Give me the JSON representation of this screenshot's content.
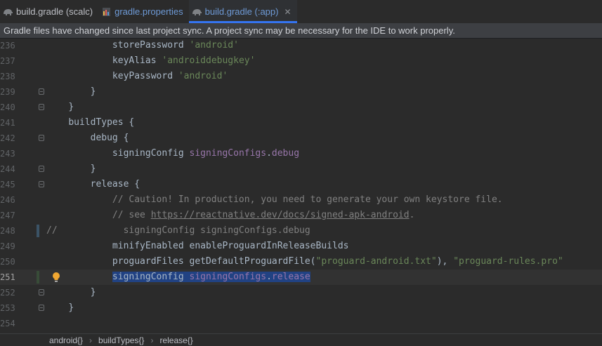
{
  "tabs": [
    {
      "label": "build.gradle (scalc)",
      "icon": "gradle-elephant-icon",
      "active": false
    },
    {
      "label": "gradle.properties",
      "icon": "properties-file-icon",
      "active": false
    },
    {
      "label": "build.gradle (:app)",
      "icon": "gradle-elephant-icon",
      "active": true
    }
  ],
  "tab_close_glyph": "✕",
  "banner": {
    "text": "Gradle files have changed since last project sync. A project sync may be necessary for the IDE to work properly."
  },
  "editor": {
    "lines": [
      {
        "num": "236",
        "indent": "        ",
        "segments": [
          {
            "t": "storePassword ",
            "c": "kw"
          },
          {
            "t": "'android'",
            "c": "str"
          }
        ]
      },
      {
        "num": "237",
        "indent": "        ",
        "segments": [
          {
            "t": "keyAlias ",
            "c": "kw"
          },
          {
            "t": "'androiddebugkey'",
            "c": "str"
          }
        ]
      },
      {
        "num": "238",
        "indent": "        ",
        "segments": [
          {
            "t": "keyPassword ",
            "c": "kw"
          },
          {
            "t": "'android'",
            "c": "str"
          }
        ]
      },
      {
        "num": "239",
        "indent": "    ",
        "segments": [
          {
            "t": "}",
            "c": "kw"
          }
        ]
      },
      {
        "num": "240",
        "indent": "",
        "segments": [
          {
            "t": "}",
            "c": "kw"
          }
        ]
      },
      {
        "num": "241",
        "indent": "",
        "segments": [
          {
            "t": "buildTypes {",
            "c": "kw"
          }
        ]
      },
      {
        "num": "242",
        "indent": "    ",
        "segments": [
          {
            "t": "debug {",
            "c": "kw"
          }
        ]
      },
      {
        "num": "243",
        "indent": "        ",
        "segments": [
          {
            "t": "signingConfig ",
            "c": "kw"
          },
          {
            "t": "signingConfigs",
            "c": "prop"
          },
          {
            "t": ".",
            "c": "kw"
          },
          {
            "t": "debug",
            "c": "prop"
          }
        ]
      },
      {
        "num": "244",
        "indent": "    ",
        "segments": [
          {
            "t": "}",
            "c": "kw"
          }
        ]
      },
      {
        "num": "245",
        "indent": "    ",
        "segments": [
          {
            "t": "release {",
            "c": "kw"
          }
        ]
      },
      {
        "num": "246",
        "indent": "        ",
        "segments": [
          {
            "t": "// Caution! In production, you need to generate your own keystore file.",
            "c": "cmt"
          }
        ]
      },
      {
        "num": "247",
        "indent": "        ",
        "segments": [
          {
            "t": "// see ",
            "c": "cmt"
          },
          {
            "t": "https://reactnative.dev/docs/signed-apk-android",
            "c": "link"
          },
          {
            "t": ".",
            "c": "cmt"
          }
        ]
      },
      {
        "num": "248",
        "indent": "",
        "segments": [
          {
            "t": "//            signingConfig signingConfigs.debug",
            "c": "cmt"
          }
        ]
      },
      {
        "num": "249",
        "indent": "        ",
        "segments": [
          {
            "t": "minifyEnabled enableProguardInReleaseBuilds",
            "c": "kw"
          }
        ]
      },
      {
        "num": "250",
        "indent": "        ",
        "segments": [
          {
            "t": "proguardFiles getDefaultProguardFile(",
            "c": "kw"
          },
          {
            "t": "\"proguard-android.txt\"",
            "c": "str"
          },
          {
            "t": "), ",
            "c": "kw"
          },
          {
            "t": "\"proguard-rules.pro\"",
            "c": "str"
          }
        ]
      },
      {
        "num": "251",
        "indent": "        ",
        "segments": [
          {
            "t": "signingConfig ",
            "c": "kw sel"
          },
          {
            "t": "signingConfigs",
            "c": "prop sel"
          },
          {
            "t": ".",
            "c": "kw sel"
          },
          {
            "t": "release",
            "c": "prop sel"
          }
        ]
      },
      {
        "num": "252",
        "indent": "    ",
        "segments": [
          {
            "t": "}",
            "c": "kw"
          }
        ]
      },
      {
        "num": "253",
        "indent": "",
        "segments": [
          {
            "t": "}",
            "c": "kw"
          }
        ]
      },
      {
        "num": "254",
        "indent": "",
        "segments": []
      }
    ],
    "current_line": "251"
  },
  "breadcrumbs": [
    "android{}",
    "buildTypes{}",
    "release{}"
  ],
  "breadcrumb_separator": "›",
  "colors": {
    "accent": "#3574f0",
    "string": "#6a8759",
    "property": "#9876aa",
    "comment": "#808080",
    "selection": "#214283"
  }
}
